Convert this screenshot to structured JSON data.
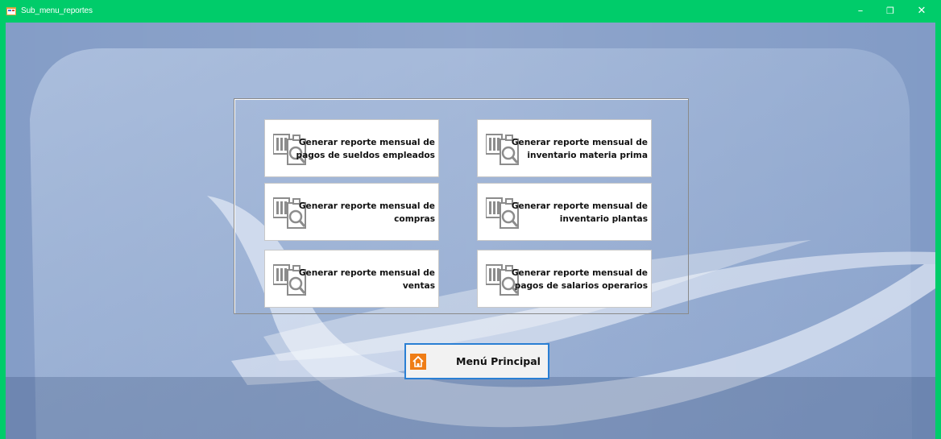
{
  "window": {
    "title": "Sub_menu_reportes",
    "controls": {
      "minimize": "–",
      "maximize": "❐",
      "close": "✕"
    }
  },
  "reports": {
    "r1": {
      "line1": "Generar reporte mensual de",
      "line2": "pagos de sueldos empleados",
      "icon": "report-search-icon"
    },
    "r2": {
      "line1": "Generar reporte mensual de",
      "line2": "inventario materia prima",
      "icon": "report-search-icon"
    },
    "r3": {
      "line1": "Generar reporte mensual de",
      "line2": "compras",
      "icon": "report-search-icon"
    },
    "r4": {
      "line1": "Generar reporte mensual de",
      "line2": "inventario plantas",
      "icon": "report-search-icon"
    },
    "r5": {
      "line1": "Generar reporte mensual de",
      "line2": "ventas",
      "icon": "report-search-icon"
    },
    "r6": {
      "line1": "Generar reporte mensual de",
      "line2": "pagos de salarios operarios",
      "icon": "report-search-icon"
    }
  },
  "main_menu": {
    "label": "Menú Principal",
    "icon": "home-icon",
    "accent": "#2a7fd4",
    "icon_color": "#ef7d16"
  },
  "colors": {
    "titlebar": "#00cc6a",
    "background_top": "#8ba6cf",
    "background_bottom": "#2d456f"
  }
}
